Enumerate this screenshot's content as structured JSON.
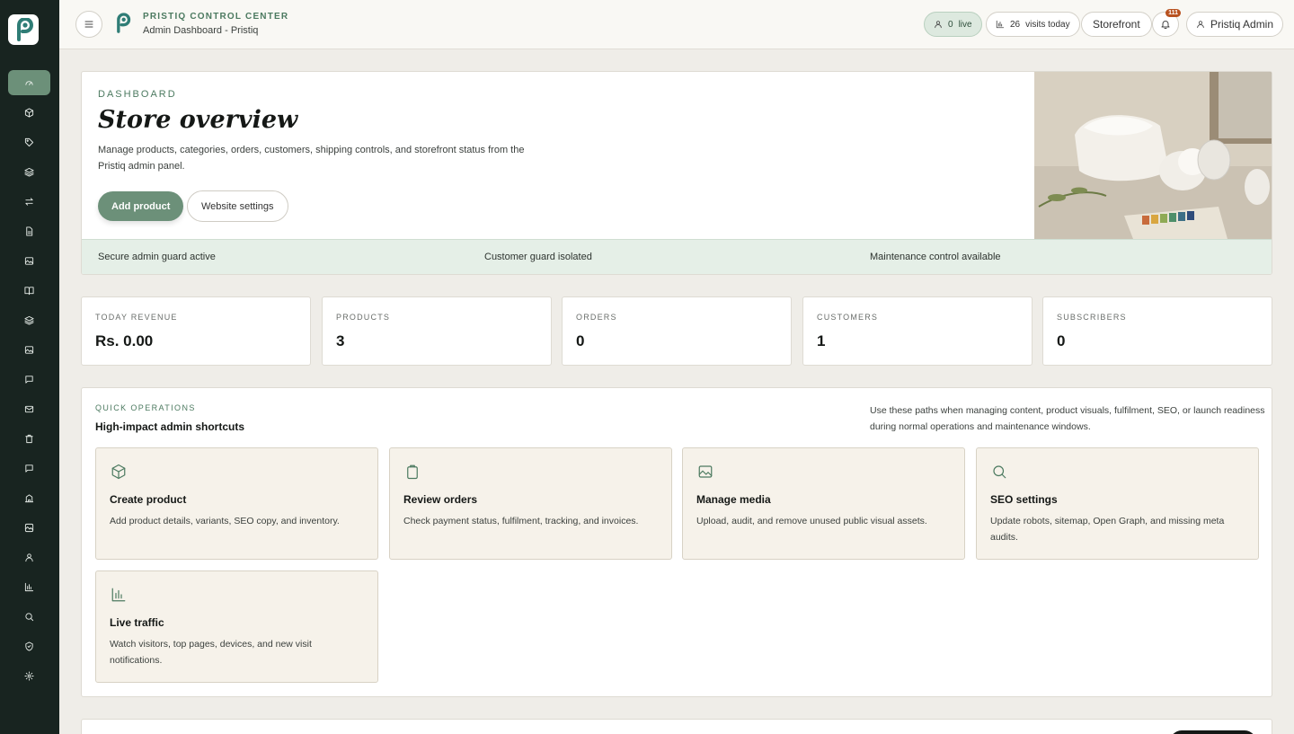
{
  "app": {
    "brand": "PRISTIQ CONTROL CENTER",
    "subtitle": "Admin Dashboard - Pristiq",
    "accent_color": "#6c9079",
    "sidebar_bg": "#182420"
  },
  "sidebar": {
    "items": [
      {
        "icon": "dashboard-icon",
        "active": true
      },
      {
        "icon": "box-icon"
      },
      {
        "icon": "tag-icon"
      },
      {
        "icon": "layers-icon"
      },
      {
        "icon": "transfer-icon"
      },
      {
        "icon": "document-icon"
      },
      {
        "icon": "image-icon"
      },
      {
        "icon": "book-icon"
      },
      {
        "icon": "layers-icon"
      },
      {
        "icon": "image-icon"
      },
      {
        "icon": "message-icon"
      },
      {
        "icon": "mail-icon"
      },
      {
        "icon": "trash-icon"
      },
      {
        "icon": "chat-icon"
      },
      {
        "icon": "building-icon"
      },
      {
        "icon": "media-icon"
      },
      {
        "icon": "user-icon"
      },
      {
        "icon": "chart-icon"
      },
      {
        "icon": "search-icon"
      },
      {
        "icon": "shield-icon"
      },
      {
        "icon": "gear-icon"
      }
    ]
  },
  "header": {
    "live_count": "0",
    "live_label": "live",
    "visits_count": "26",
    "visits_label": "visits today",
    "storefront_label": "Storefront",
    "notifications_count": "111",
    "admin_label": "Pristiq Admin"
  },
  "overview": {
    "eyebrow": "DASHBOARD",
    "title": "Store overview",
    "description": "Manage products, categories, orders, customers, shipping controls, and storefront status from the Pristiq admin panel.",
    "primary_button": "Add product",
    "secondary_button": "Website settings",
    "status": [
      "Secure admin guard active",
      "Customer guard isolated",
      "Maintenance control available"
    ]
  },
  "stats": [
    {
      "label": "TODAY REVENUE",
      "value": "Rs. 0.00"
    },
    {
      "label": "PRODUCTS",
      "value": "3"
    },
    {
      "label": "ORDERS",
      "value": "0"
    },
    {
      "label": "CUSTOMERS",
      "value": "1"
    },
    {
      "label": "SUBSCRIBERS",
      "value": "0"
    }
  ],
  "quick_ops": {
    "eyebrow": "QUICK OPERATIONS",
    "title": "High-impact admin shortcuts",
    "note": "Use these paths when managing content, product visuals, fulfilment, SEO, or launch readiness during normal operations and maintenance windows.",
    "tiles": [
      {
        "icon": "box-icon",
        "title": "Create product",
        "description": "Add product details, variants, SEO copy, and inventory."
      },
      {
        "icon": "clipboard-icon",
        "title": "Review orders",
        "description": "Check payment status, fulfilment, tracking, and invoices."
      },
      {
        "icon": "image-icon",
        "title": "Manage media",
        "description": "Upload, audit, and remove unused public visual assets."
      },
      {
        "icon": "search-icon",
        "title": "SEO settings",
        "description": "Update robots, sitemap, Open Graph, and missing meta audits."
      },
      {
        "icon": "chart-icon",
        "title": "Live traffic",
        "description": "Watch visitors, top pages, devices, and new visit notifications."
      }
    ]
  }
}
